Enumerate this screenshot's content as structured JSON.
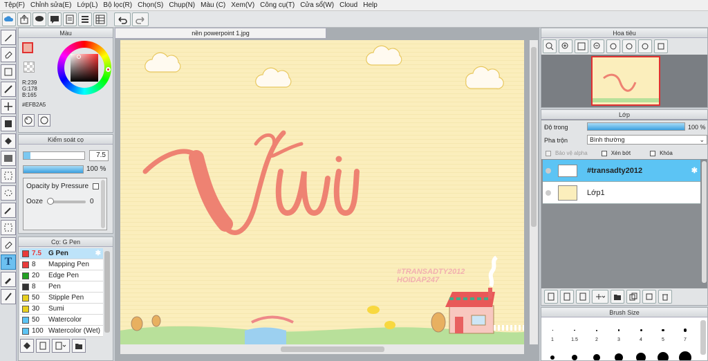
{
  "menu": [
    "Tệp(F)",
    "Chỉnh sửa(E)",
    "Lớp(L)",
    "Bộ lọc(R)",
    "Chọn(S)",
    "Chụp(N)",
    "Màu (C)",
    "Xem(V)",
    "Công cụ(T)",
    "Cửa sổ(W)",
    "Cloud",
    "Help"
  ],
  "color_panel": {
    "title": "Màu",
    "r": "R:239",
    "g": "G:178",
    "b": "B:165",
    "hex": "#EFB2A5",
    "fg": "#efb2a5"
  },
  "brush_control": {
    "title": "Kiểm soát cọ",
    "size": "7.5",
    "opacity": "100 %",
    "opacity_pressure": "Opacity by Pressure",
    "ooze": "Ooze",
    "ooze_val": "0"
  },
  "brush_list": {
    "title": "Cọ: G Pen",
    "items": [
      {
        "size": "7.5",
        "name": "G Pen",
        "color": "#e83a3a",
        "sel": true
      },
      {
        "size": "8",
        "name": "Mapping Pen",
        "color": "#e83a3a"
      },
      {
        "size": "20",
        "name": "Edge Pen",
        "color": "#22a022"
      },
      {
        "size": "8",
        "name": "Pen",
        "color": "#333333"
      },
      {
        "size": "50",
        "name": "Stipple Pen",
        "color": "#e8d020"
      },
      {
        "size": "30",
        "name": "Sumi",
        "color": "#e8d020"
      },
      {
        "size": "50",
        "name": "Watercolor",
        "color": "#5cc4f4"
      },
      {
        "size": "100",
        "name": "Watercolor (Wet)",
        "color": "#5cc4f4"
      }
    ]
  },
  "document": {
    "tab": "nền powerpoint 1.jpg",
    "title_text": "Vui",
    "tag1": "#TRANSADTY2012",
    "tag2": "HOIDAP247"
  },
  "navigator": {
    "title": "Hoa tiêu"
  },
  "layers": {
    "title": "Lớp",
    "opacity_label": "Độ trong",
    "opacity_val": "100 %",
    "blend_label": "Pha trộn",
    "blend_val": "Bình thường",
    "protect_alpha": "Bảo vệ alpha",
    "clip": "Xén bớt",
    "lock": "Khóa",
    "items": [
      {
        "name": "#transadty2012",
        "sel": true
      },
      {
        "name": "Lớp1",
        "sel": false
      }
    ]
  },
  "brush_size": {
    "title": "Brush Size",
    "labels": [
      "1",
      "1.5",
      "2",
      "3",
      "4",
      "5",
      "7"
    ]
  }
}
